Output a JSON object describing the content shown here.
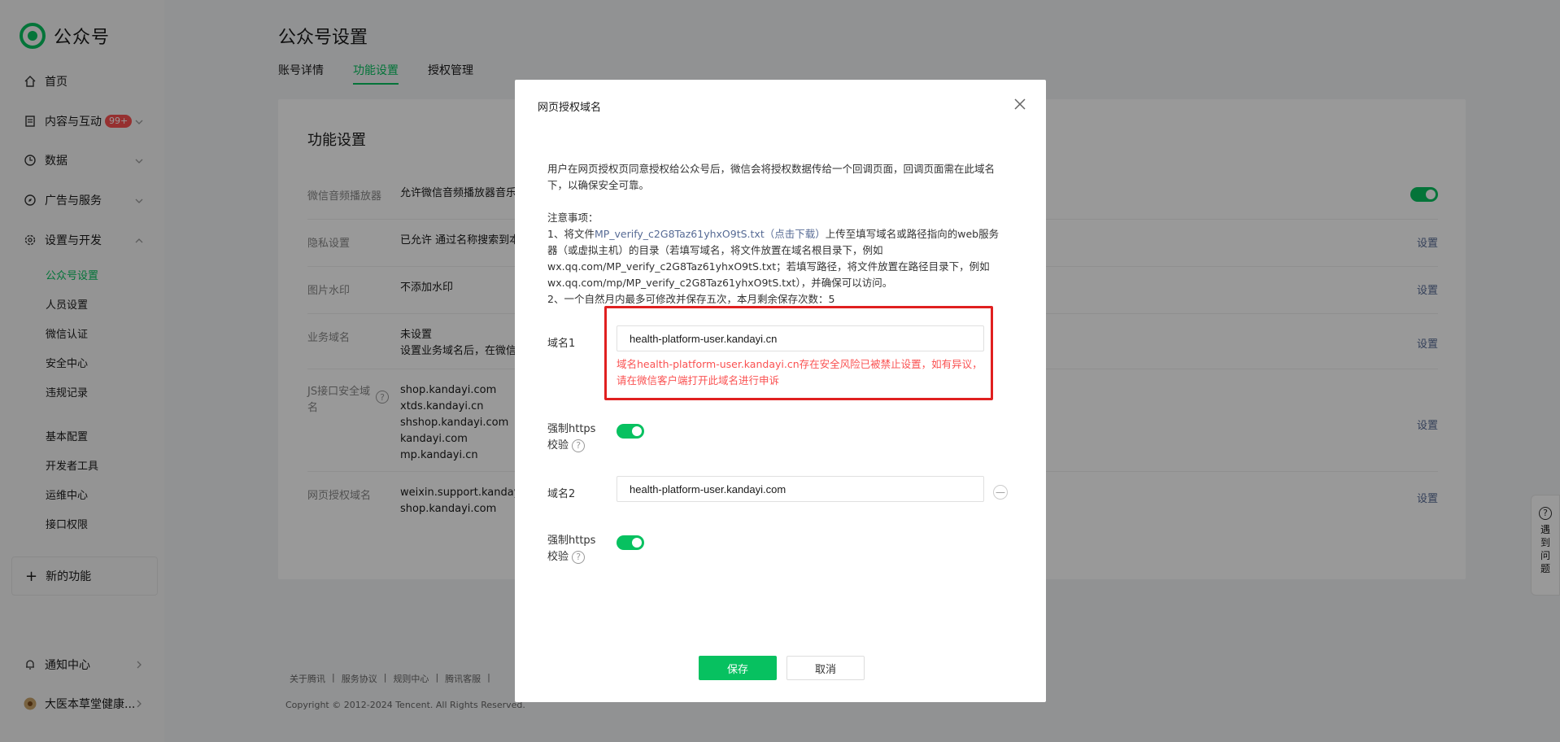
{
  "app": {
    "logo_text": "公众号"
  },
  "sidebar": {
    "home": "首页",
    "content": "内容与互动",
    "content_badge": "99+",
    "data": "数据",
    "ads": "广告与服务",
    "settings": "设置与开发",
    "sub": [
      "公众号设置",
      "人员设置",
      "微信认证",
      "安全中心",
      "违规记录",
      "基本配置",
      "开发者工具",
      "运维中心",
      "接口权限"
    ],
    "new_function": "新的功能",
    "notify": "通知中心",
    "account": "大医本草堂健康..."
  },
  "main": {
    "title": "公众号设置",
    "tabs": [
      "账号详情",
      "功能设置",
      "授权管理"
    ],
    "card_title": "功能设置",
    "rows": [
      {
        "label": "微信音频播放器",
        "value": "允许微信音频播放器音乐名"
      },
      {
        "label": "隐私设置",
        "value": "已允许 通过名称搜索到本",
        "action": "设置"
      },
      {
        "label": "图片水印",
        "value": "不添加水印",
        "action": "设置"
      },
      {
        "label": "业务域名",
        "value": "未设置",
        "value2": "设置业务域名后，在微信内",
        "action": "设置"
      },
      {
        "label": "JS接口安全域名",
        "values": [
          "shop.kandayi.com",
          "xtds.kandayi.cn",
          "shshop.kandayi.com",
          "kandayi.com",
          "mp.kandayi.cn"
        ],
        "action": "设置"
      },
      {
        "label": "网页授权域名",
        "values": [
          "weixin.support.kandayi.",
          "shop.kandayi.com"
        ],
        "action": "设置"
      }
    ],
    "footer_links": [
      "关于腾讯",
      "|",
      "服务协议",
      "|",
      "规则中心",
      "|",
      "腾讯客服",
      "|"
    ],
    "copyright": "Copyright © 2012-2024 Tencent. All Rights Reserved.",
    "help": [
      "遇",
      "到",
      "问",
      "题"
    ]
  },
  "modal": {
    "title": "网页授权域名",
    "intro": "用户在网页授权页同意授权给公众号后，微信会将授权数据传给一个回调页面，回调页面需在此域名下，以确保安全可靠。",
    "notes_title": "注意事项：",
    "note1_prefix": "1、将文件",
    "note1_link": "MP_verify_c2G8Taz61yhxO9tS.txt（点击下载）",
    "note1_suffix": "上传至填写域名或路径指向的web服务器（或虚拟主机）的目录（若填写域名，将文件放置在域名根目录下，例如wx.qq.com/MP_verify_c2G8Taz61yhxO9tS.txt；若填写路径，将文件放置在路径目录下，例如wx.qq.com/mp/MP_verify_c2G8Taz61yhxO9tS.txt），并确保可以访问。",
    "note2": "2、一个自然月内最多可修改并保存五次，本月剩余保存次数：5",
    "domain1_label": "域名1",
    "domain1_value": "health-platform-user.kandayi.cn",
    "error": "域名health-platform-user.kandayi.cn存在安全风险已被禁止设置，如有异议，请在微信客户端打开此域名进行申诉",
    "https_label_a": "强制https",
    "https_label_b": "校验",
    "domain2_label": "域名2",
    "domain2_value": "health-platform-user.kandayi.com",
    "save": "保存",
    "cancel": "取消"
  }
}
